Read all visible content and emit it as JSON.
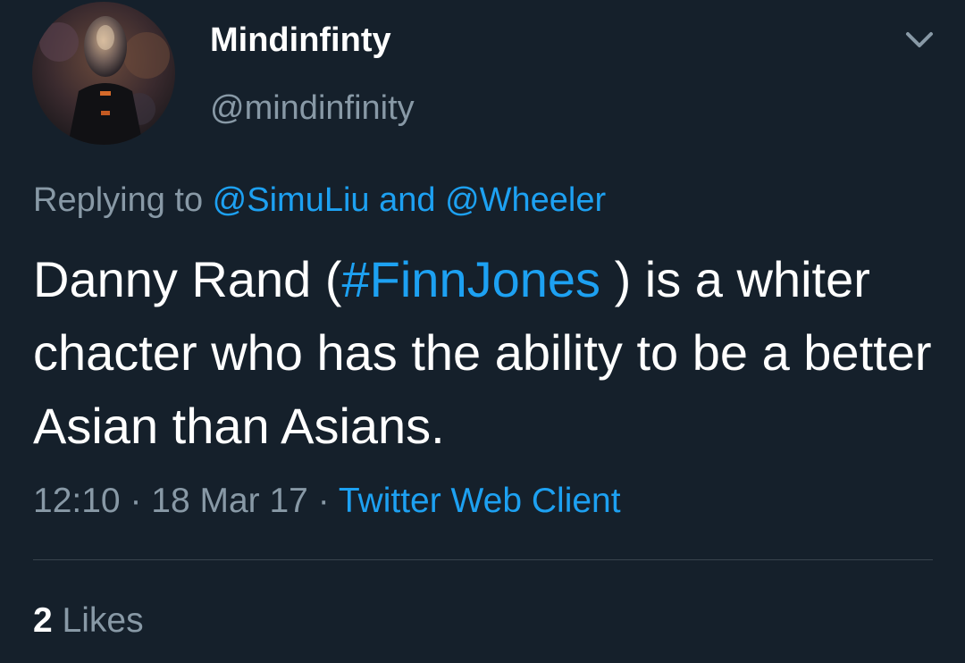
{
  "colors": {
    "background": "#15202b",
    "text_primary": "#ffffff",
    "text_secondary": "#8899a6",
    "link": "#1da1f2",
    "divider": "#38444d"
  },
  "user": {
    "display_name": "Mindinfinty",
    "handle": "@mindinfinity",
    "avatar_icon": "avatar-image"
  },
  "menu": {
    "icon": "chevron-down-icon"
  },
  "reply": {
    "prefix": "Replying to ",
    "mention_1": "@SimuLiu",
    "conjunction": " and ",
    "mention_2": "@Wheeler"
  },
  "tweet": {
    "text_before": "Danny Rand (",
    "hashtag": "#FinnJones",
    "text_after": " ) is a whiter chacter who has the ability to be a better Asian than Asians."
  },
  "meta": {
    "time": "12:10",
    "separator_1": " · ",
    "date": "18 Mar 17",
    "separator_2": " · ",
    "source": "Twitter Web Client"
  },
  "stats": {
    "likes_count": "2",
    "likes_label": " Likes"
  }
}
